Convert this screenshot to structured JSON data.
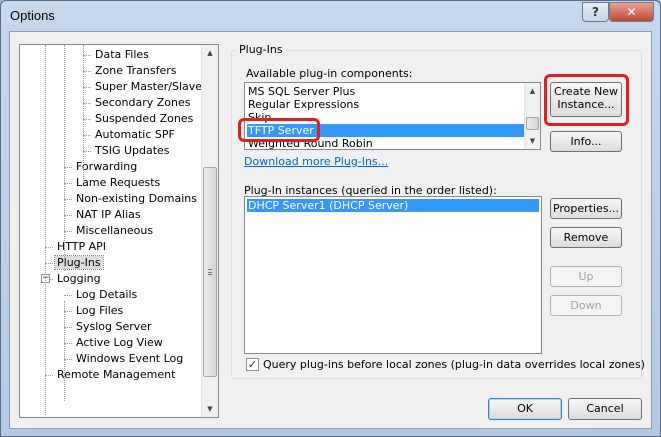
{
  "window": {
    "title": "Options",
    "help_label": "?",
    "close_label": "✕"
  },
  "tree": {
    "items": [
      {
        "label": "Data Files",
        "level": 3
      },
      {
        "label": "Zone Transfers",
        "level": 3
      },
      {
        "label": "Super Master/Slave",
        "level": 3
      },
      {
        "label": "Secondary Zones",
        "level": 3
      },
      {
        "label": "Suspended Zones",
        "level": 3
      },
      {
        "label": "Automatic SPF",
        "level": 3
      },
      {
        "label": "TSIG Updates",
        "level": 3
      },
      {
        "label": "Forwarding",
        "level": 2
      },
      {
        "label": "Lame Requests",
        "level": 2
      },
      {
        "label": "Non-existing Domains",
        "level": 2
      },
      {
        "label": "NAT IP Alias",
        "level": 2
      },
      {
        "label": "Miscellaneous",
        "level": 2
      },
      {
        "label": "HTTP API",
        "level": 1
      },
      {
        "label": "Plug-Ins",
        "level": 1,
        "selected": true
      },
      {
        "label": "Logging",
        "level": 1,
        "expander": "−"
      },
      {
        "label": "Log Details",
        "level": 2
      },
      {
        "label": "Log Files",
        "level": 2
      },
      {
        "label": "Syslog Server",
        "level": 2
      },
      {
        "label": "Active Log View",
        "level": 2
      },
      {
        "label": "Windows Event Log",
        "level": 2
      },
      {
        "label": "Remote Management",
        "level": 1
      }
    ]
  },
  "plugins": {
    "group_label": "Plug-Ins",
    "available_label": "Available plug-in components:",
    "components": [
      "MS SQL Server Plus",
      "Regular Expressions",
      "Skip",
      "TFTP Server",
      "Weighted Round Robin"
    ],
    "selected_component": "TFTP Server",
    "download_link": "Download more Plug-Ins...",
    "create_button": [
      "Create New",
      "Instance..."
    ],
    "info_button": "Info...",
    "instances_label": "Plug-In instances (queried in the order listed):",
    "instances": [
      "DHCP Server1 (DHCP Server)"
    ],
    "properties_button": "Properties...",
    "remove_button": "Remove",
    "up_button": "Up",
    "down_button": "Down",
    "query_checkbox_label": "Query plug-ins before local zones (plug-in data overrides local zones)",
    "query_checkbox_checked": true
  },
  "footer": {
    "ok_label": "OK",
    "cancel_label": "Cancel"
  },
  "colors": {
    "selection": "#3399ff",
    "highlight_box": "#e02020",
    "link": "#0066cc"
  }
}
